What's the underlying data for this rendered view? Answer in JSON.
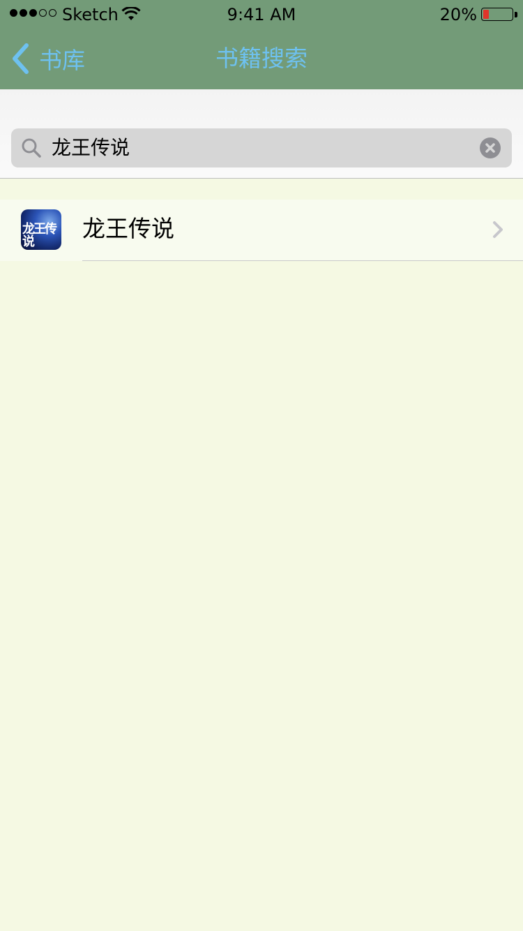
{
  "status_bar": {
    "carrier": "Sketch",
    "time": "9:41 AM",
    "battery_percent": "20%",
    "battery_level": 0.2,
    "signal_full_dots": 3,
    "signal_total_dots": 5
  },
  "nav": {
    "back_label": "书库",
    "title": "书籍搜索"
  },
  "search": {
    "value": "龙王传说"
  },
  "results": [
    {
      "title": "龙王传说",
      "cover_text": "龙王传说"
    }
  ],
  "colors": {
    "nav_background": "#739B78",
    "nav_tint": "#6EC1F0",
    "page_background": "#F5F9E3",
    "battery_low": "#E0352B"
  }
}
